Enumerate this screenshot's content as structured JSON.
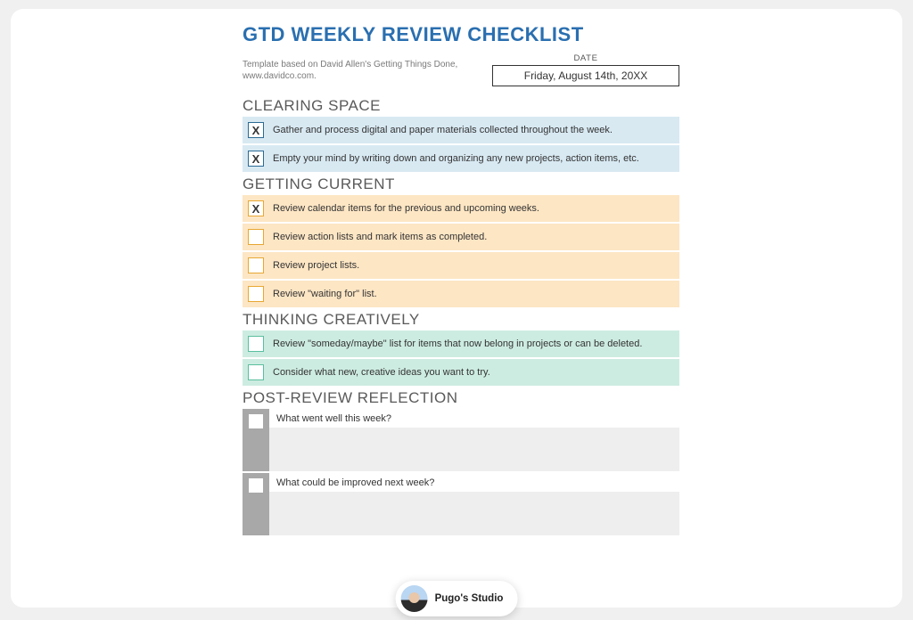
{
  "title": "GTD WEEKLY REVIEW CHECKLIST",
  "template_note": "Template based on David Allen's Getting Things Done, www.davidco.com.",
  "date": {
    "label": "DATE",
    "value": "Friday, August 14th, 20XX"
  },
  "sections": {
    "clearing": {
      "heading": "CLEARING SPACE",
      "items": [
        {
          "checked": true,
          "text": "Gather and process digital and paper materials collected throughout the week."
        },
        {
          "checked": true,
          "text": "Empty your mind by writing down and organizing any new projects, action items, etc."
        }
      ]
    },
    "current": {
      "heading": "GETTING CURRENT",
      "items": [
        {
          "checked": true,
          "text": "Review calendar items for the previous and upcoming weeks."
        },
        {
          "checked": false,
          "text": "Review action lists and mark items as completed."
        },
        {
          "checked": false,
          "text": "Review project lists."
        },
        {
          "checked": false,
          "text": "Review \"waiting for\" list."
        }
      ]
    },
    "creative": {
      "heading": "THINKING CREATIVELY",
      "items": [
        {
          "checked": false,
          "text": "Review \"someday/maybe\" list for items that now belong in projects or can be deleted."
        },
        {
          "checked": false,
          "text": "Consider what new, creative ideas you want to try."
        }
      ]
    },
    "reflection": {
      "heading": "POST-REVIEW REFLECTION",
      "questions": [
        "What went well this week?",
        "What could be improved next week?"
      ]
    }
  },
  "author": {
    "name": "Pugo's Studio"
  }
}
